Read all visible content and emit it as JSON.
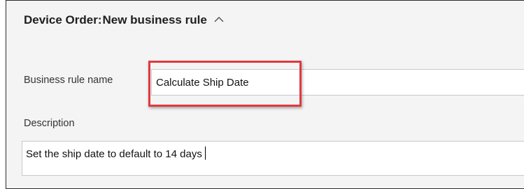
{
  "header": {
    "entity": "Device Order:",
    "title": "New business rule",
    "collapse_icon": "chevron-up-icon"
  },
  "form": {
    "rule_name_label": "Business rule name",
    "rule_name_value": "Calculate Ship Date",
    "description_label": "Description",
    "description_value": "Set the ship date to default to 14 days"
  },
  "colors": {
    "highlight": "#e0393f",
    "panel_background": "#f4f4f4"
  }
}
